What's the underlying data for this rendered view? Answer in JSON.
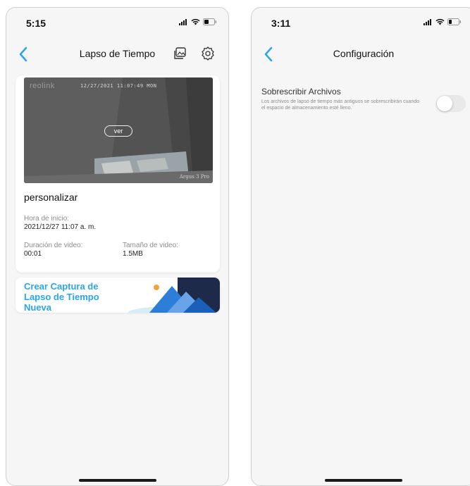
{
  "colors": {
    "accent": "#29a6e6",
    "page_bg": "#f6f6f6",
    "card_bg": "#ffffff"
  },
  "left_screen": {
    "status_time": "5:15",
    "title": "Lapso de Tiempo",
    "icons": [
      "back-icon",
      "gallery-icon",
      "gear-icon"
    ],
    "video": {
      "osd_timestamp": "12/27/2021 11:07:49 MON",
      "logo": "reolink",
      "camera_model": "Argus 3 Pro",
      "play_label": "ver"
    },
    "card": {
      "title": "personalizar",
      "start_label": "Hora de inicio:",
      "start_value": "2021/12/27 11:07 a. m.",
      "duration_label": "Duración de video:",
      "duration_value": "00:01",
      "size_label": "Tamaño de video:",
      "size_value": "1.5MB"
    },
    "create_banner": {
      "label": "Crear Captura de Lapso de Tiempo Nueva"
    }
  },
  "right_screen": {
    "status_time": "3:11",
    "title": "Configuración",
    "setting": {
      "title": "Sobrescribir Archivos",
      "description": "Los archivos de lapso de tiempo más antiguos se sobrescribirán cuando el espacio de almacenamiento esté lleno.",
      "enabled": false
    }
  }
}
